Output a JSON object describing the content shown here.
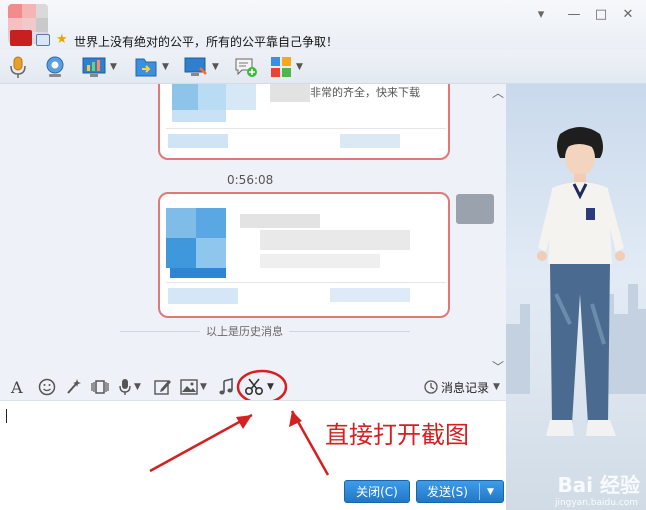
{
  "header": {
    "signature": "世界上没有绝对的公平，所有的公平靠自己争取！"
  },
  "window_controls": {
    "menu_glyph": "▾",
    "minimize_glyph": "—",
    "maximize_glyph": "□",
    "close_glyph": "✕"
  },
  "chat": {
    "bubble1_text": "非常的齐全，快来下载",
    "timestamp": "0:56:08",
    "history_text": "以上是历史消息",
    "collapse_up": "︿",
    "collapse_down": "﹀"
  },
  "input_toolbar": {
    "history_label": "消息记录"
  },
  "input_area": {
    "annotation": "直接打开截图"
  },
  "buttons": {
    "close_label": "关闭(C)",
    "send_label": "发送(S)",
    "send_arrow": "▼"
  },
  "watermark": {
    "main": "Bai 经验",
    "sub": "jingyan.baidu.com"
  },
  "colors": {
    "accent_red": "#d42020",
    "button_blue": "#1f78c8",
    "bubble_border": "#e07878"
  }
}
